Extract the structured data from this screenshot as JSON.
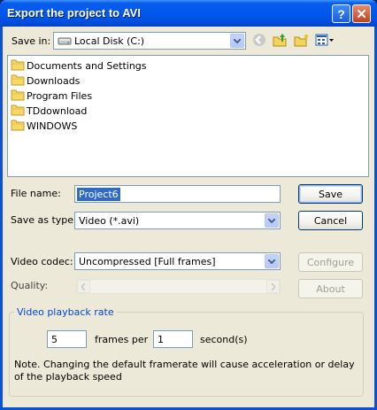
{
  "window": {
    "title": "Export the project to AVI"
  },
  "location": {
    "label": "Save in:",
    "value": "Local Disk (C:)"
  },
  "folders": [
    "Documents and Settings",
    "Downloads",
    "Program Files",
    "TDdownload",
    "WINDOWS"
  ],
  "file_name": {
    "label": "File name:",
    "value": "Project6"
  },
  "save_as_type": {
    "label": "Save as type:",
    "value": "Video (*.avi)"
  },
  "buttons": {
    "save": "Save",
    "cancel": "Cancel",
    "configure": "Configure",
    "about": "About"
  },
  "video_codec": {
    "label": "Video codec:",
    "value": "Uncompressed [Full frames]"
  },
  "quality": {
    "label": "Quality:"
  },
  "playback": {
    "group_title": "Video playback rate",
    "frames": "5",
    "frames_per_label": "frames per",
    "seconds": "1",
    "seconds_label": "second(s)",
    "note": "Note. Changing the default framerate will cause acceleration or delay of the playback speed"
  },
  "colors": {
    "titlebar": "#0058ee",
    "dialog_bg": "#ece9d8",
    "selection": "#316ac5",
    "group_title": "#0046d5"
  },
  "icons": [
    "help-icon",
    "close-icon",
    "drive-icon",
    "back-icon",
    "up-folder-icon",
    "new-folder-icon",
    "views-menu-icon",
    "folder-icon"
  ]
}
